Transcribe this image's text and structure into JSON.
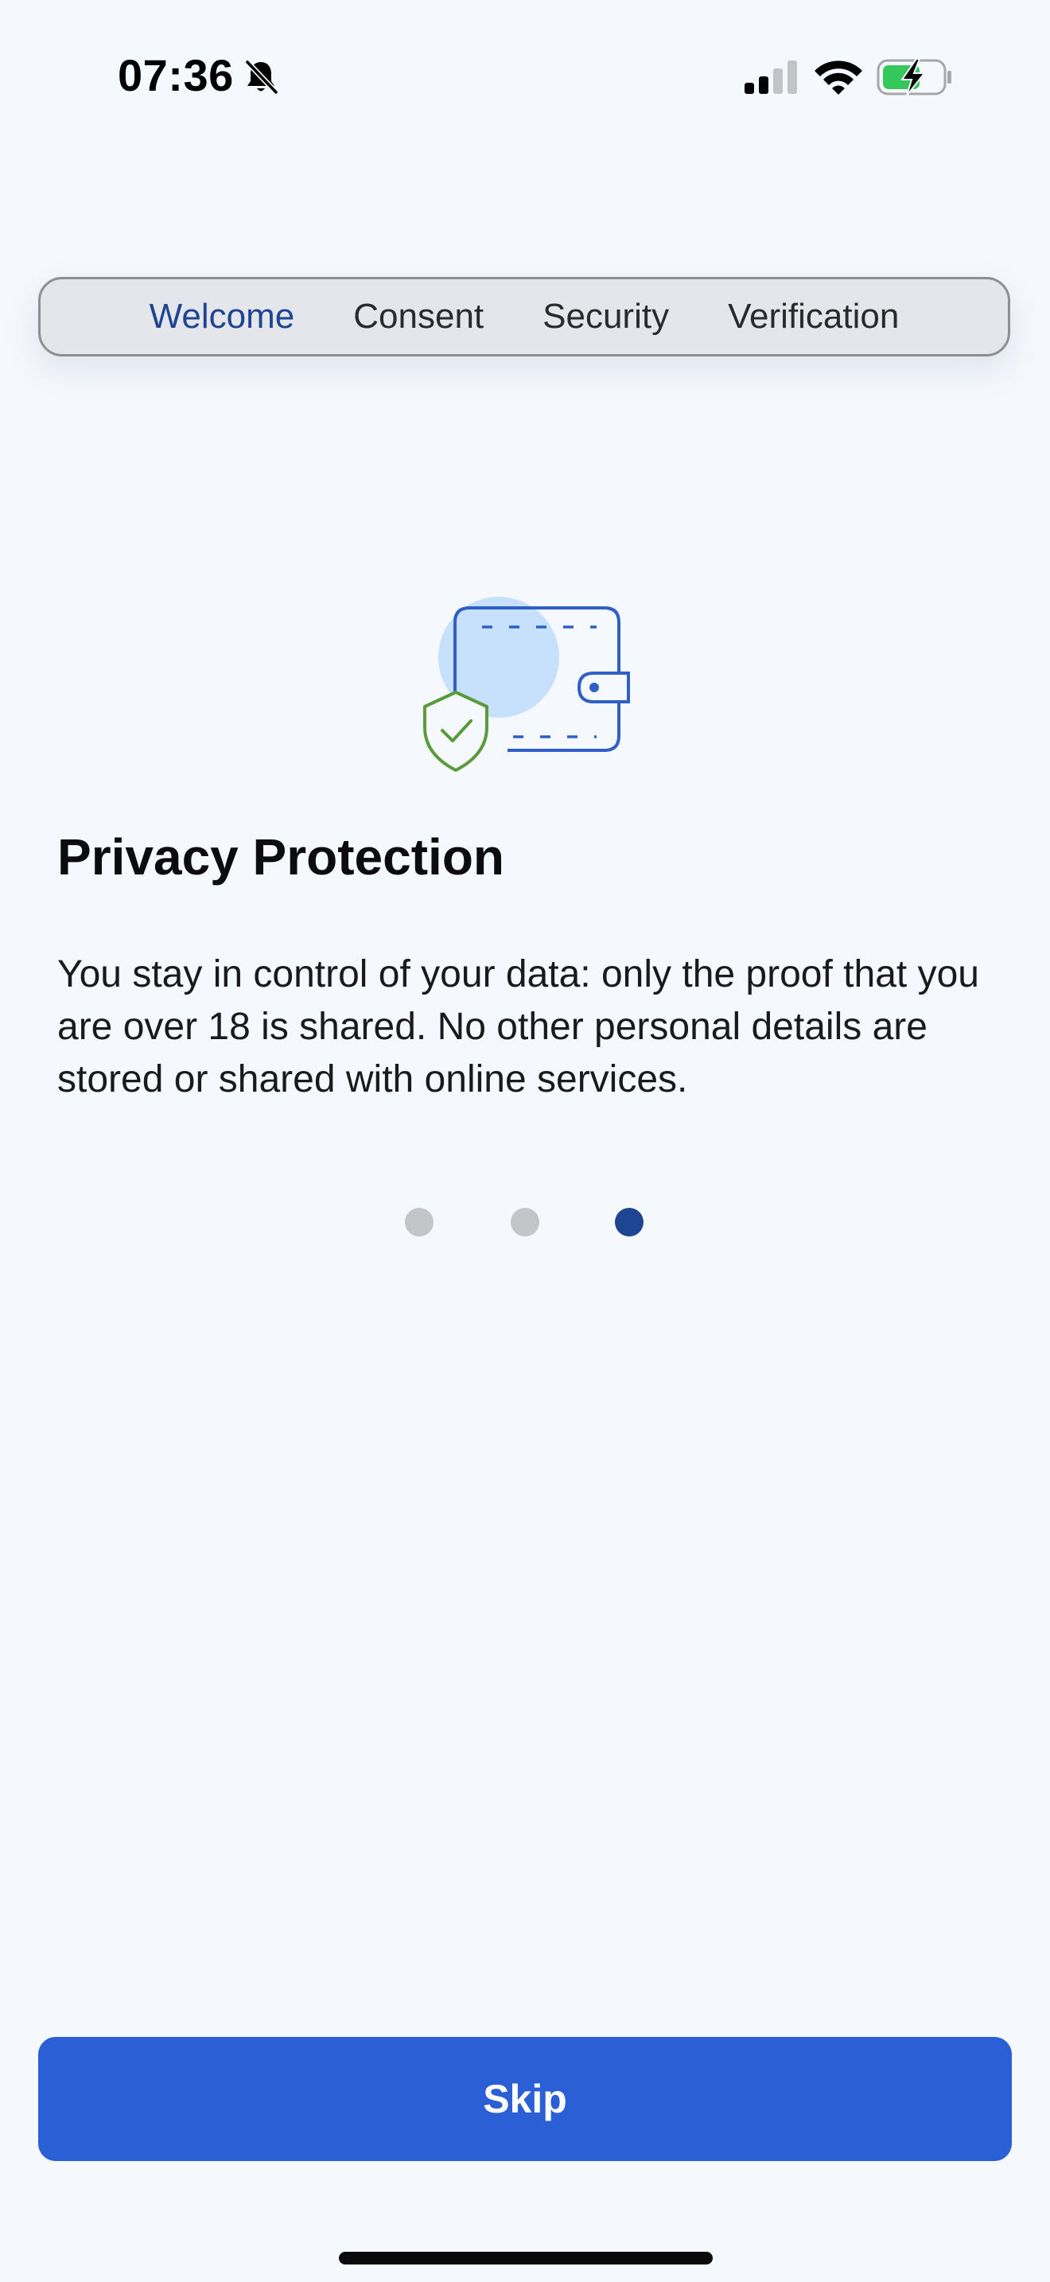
{
  "status_bar": {
    "time": "07:36",
    "icons": [
      "bell-slash-icon",
      "cellular-signal-icon",
      "wifi-icon",
      "battery-charging-icon"
    ],
    "battery_color": "#34c759"
  },
  "tabs": [
    {
      "label": "Welcome",
      "active": true
    },
    {
      "label": "Consent",
      "active": false
    },
    {
      "label": "Security",
      "active": false
    },
    {
      "label": "Verification",
      "active": false
    }
  ],
  "illustration": {
    "icons": [
      "wallet-icon",
      "shield-check-icon"
    ],
    "colors": {
      "wallet": "#2f5fc7",
      "circle": "#c7e0fb",
      "shield": "#5a9a3a"
    }
  },
  "content": {
    "title": "Privacy Protection",
    "body": "You stay in control of your data: only the proof that you are over 18 is shared. No other personal details are stored or shared with online services."
  },
  "pager": {
    "total": 3,
    "current": 3,
    "active_color": "#1d4592",
    "inactive_color": "#c4c5c8"
  },
  "actions": {
    "skip_label": "Skip",
    "button_color": "#2a5fd6"
  }
}
